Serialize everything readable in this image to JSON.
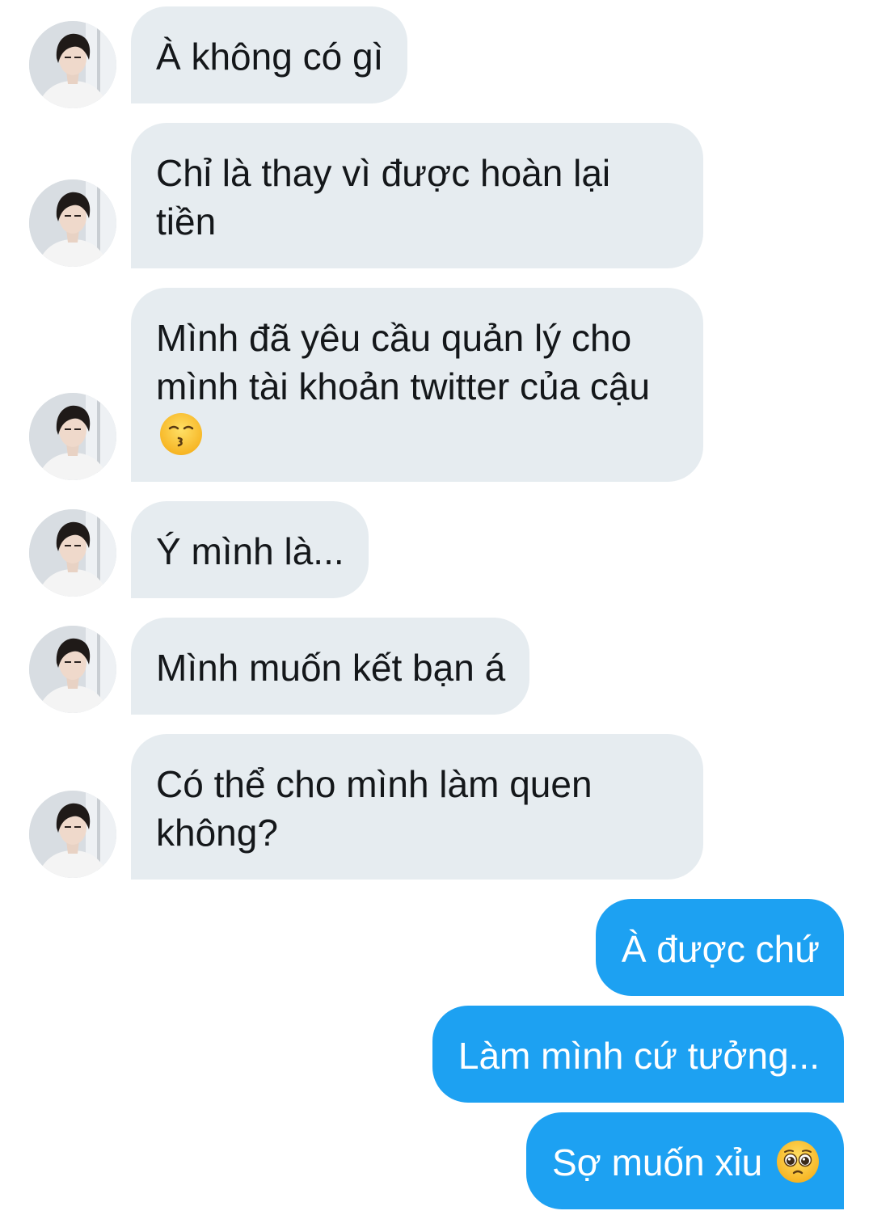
{
  "conversation": {
    "incoming": [
      {
        "text": "À không có gì",
        "emoji": null
      },
      {
        "text": "Chỉ là thay vì được hoàn lại tiền",
        "emoji": null
      },
      {
        "text": "Mình đã yêu cầu quản lý cho mình tài khoản twitter của cậu",
        "emoji": "kissing-face"
      },
      {
        "text": "Ý mình là...",
        "emoji": null
      },
      {
        "text": "Mình muốn kết bạn á",
        "emoji": null
      },
      {
        "text": "Có thể cho mình làm quen không?",
        "emoji": null
      }
    ],
    "outgoing": [
      {
        "text": "À được chứ",
        "emoji": null
      },
      {
        "text": "Làm mình cứ tưởng...",
        "emoji": null
      },
      {
        "text": "Sợ muốn xỉu",
        "emoji": "pleading-face"
      }
    ]
  },
  "colors": {
    "incoming_bubble": "#e6ecf0",
    "incoming_text": "#14171a",
    "outgoing_bubble": "#1da1f2",
    "outgoing_text": "#ffffff"
  },
  "icons": [
    "avatar",
    "kissing-face-emoji",
    "pleading-face-emoji"
  ]
}
